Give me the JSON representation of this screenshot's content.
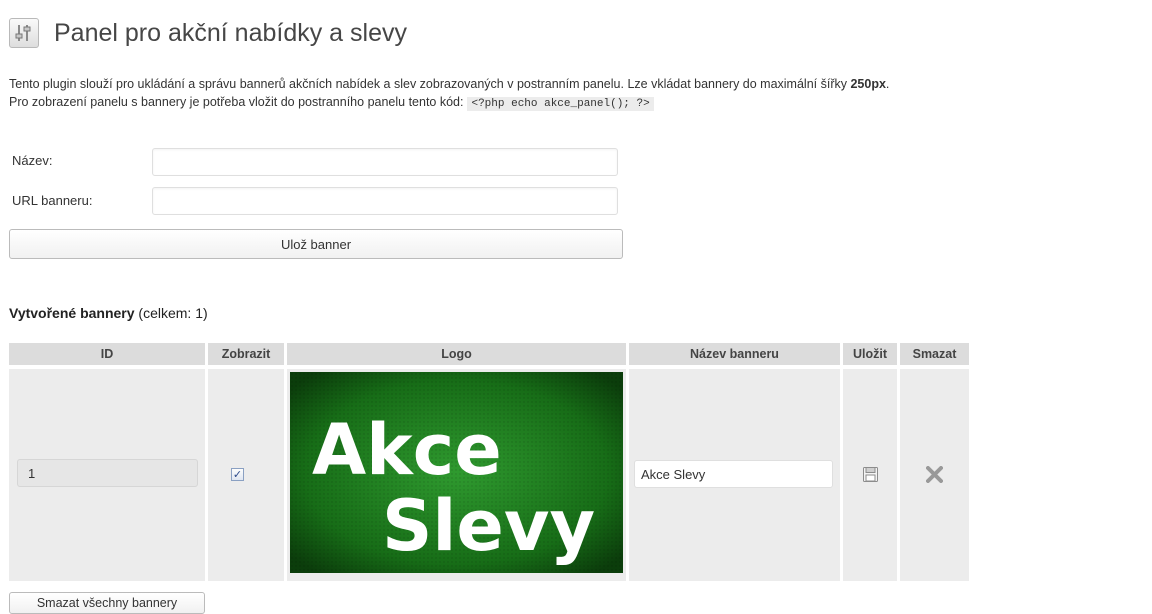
{
  "header": {
    "title": "Panel pro akční nabídky a slevy",
    "icon": "settings-sliders-icon"
  },
  "description": {
    "line1_text": "Tento plugin slouží pro ukládání a správu bannerů akčních nabídek a slev zobrazovaných v postranním panelu. Lze vkládat bannery do maximální šířky ",
    "line1_bold": "250px",
    "line1_end": ".",
    "line2_text": "Pro zobrazení panelu s bannery je potřeba vložit do postranního panelu tento kód:",
    "code": "<?php echo akce_panel(); ?>"
  },
  "form": {
    "name_label": "Název:",
    "name_value": "",
    "url_label": "URL banneru:",
    "url_value": "",
    "save_button": "Ulož banner"
  },
  "banners": {
    "title": "Vytvořené bannery",
    "count_text": "(celkem: 1)",
    "columns": [
      "ID",
      "Zobrazit",
      "Logo",
      "Název banneru",
      "Uložit",
      "Smazat"
    ],
    "rows": [
      {
        "id": "1",
        "show": true,
        "logo_text_line1": "Akce",
        "logo_text_line2": "Slevy",
        "name": "Akce Slevy",
        "save_icon": "floppy-disk-icon",
        "delete_icon": "close-x-icon"
      }
    ],
    "delete_all_button": "Smazat všechny bannery"
  },
  "colors": {
    "logo_green_dark": "#0b3d0b",
    "logo_green_light": "#2f9a2f",
    "header_bg": "#dcdcdc",
    "cell_bg": "#ececec"
  }
}
